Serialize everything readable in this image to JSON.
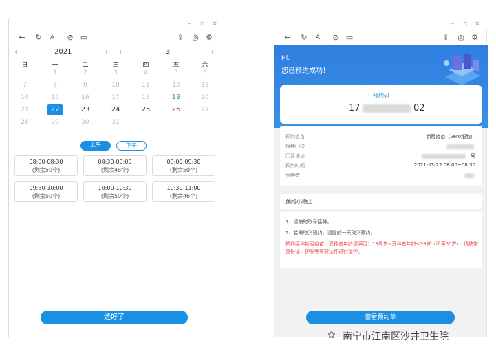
{
  "left_window": {
    "toolbar_icons": [
      "back-arrow-icon",
      "refresh-icon",
      "font-icon",
      "link-icon",
      "window-icon",
      "share-icon",
      "settings-icon",
      "gear-icon"
    ],
    "calendar": {
      "year": "2021",
      "month": "3",
      "weekdays": [
        "日",
        "一",
        "二",
        "三",
        "四",
        "五",
        "六"
      ],
      "weeks": [
        [
          "",
          "1",
          "2",
          "3",
          "4",
          "5",
          "6"
        ],
        [
          "7",
          "8",
          "9",
          "10",
          "11",
          "12",
          "13"
        ],
        [
          "14",
          "15",
          "16",
          "17",
          "18",
          "19",
          "20"
        ],
        [
          "21",
          "22",
          "23",
          "24",
          "25",
          "26",
          "27"
        ],
        [
          "28",
          "29",
          "30",
          "31",
          "",
          "",
          ""
        ]
      ],
      "selected_day": "22",
      "highlight_day": "19",
      "available_days": [
        "22",
        "23",
        "24",
        "25",
        "26"
      ]
    },
    "period_tabs": {
      "am": "上午",
      "pm": "下午"
    },
    "slots": [
      {
        "time": "08:00-08:30",
        "remain": "(剩余50个)"
      },
      {
        "time": "08:30-09:00",
        "remain": "(剩余48个)"
      },
      {
        "time": "09:00-09:30",
        "remain": "(剩余50个)"
      },
      {
        "time": "09:30-10:00",
        "remain": "(剩余50个)"
      },
      {
        "time": "10:00-10:30",
        "remain": "(剩余50个)"
      },
      {
        "time": "10:30-11:00",
        "remain": "(剩余46个)"
      }
    ],
    "confirm_label": "选好了"
  },
  "right_window": {
    "greeting": "Hi,",
    "success_text": "您已预约成功！",
    "code_label": "预约码",
    "code_prefix": "17",
    "code_suffix": "02",
    "details": [
      {
        "label": "预约疫苗",
        "value": "新冠疫苗（Vero细胞）"
      },
      {
        "label": "接种门诊",
        "value": ""
      },
      {
        "label": "门诊地址",
        "value": "号"
      },
      {
        "label": "预约时间",
        "value": "2021-03-22 08:00~08:30"
      },
      {
        "label": "受种者",
        "value": ""
      }
    ],
    "tips_title": "预约小贴士",
    "tips": [
      "1、请按时取号接种。",
      "2、若需取消预约，请提前一天取消预约。"
    ],
    "warning": "预约接种新冠疫苗，受种者年龄须满足：18周岁≤受种者年龄≤59岁（不满60岁），请携带身份证、护照等有效证件进行接种。",
    "view_button": "查看预约单"
  },
  "watermark": "南宁市江南区沙井卫生院",
  "colors": {
    "primary": "#1a8fe3",
    "accent_green": "#19a06b",
    "warning_red": "#e5484d",
    "banner": "#2f7fe0"
  }
}
